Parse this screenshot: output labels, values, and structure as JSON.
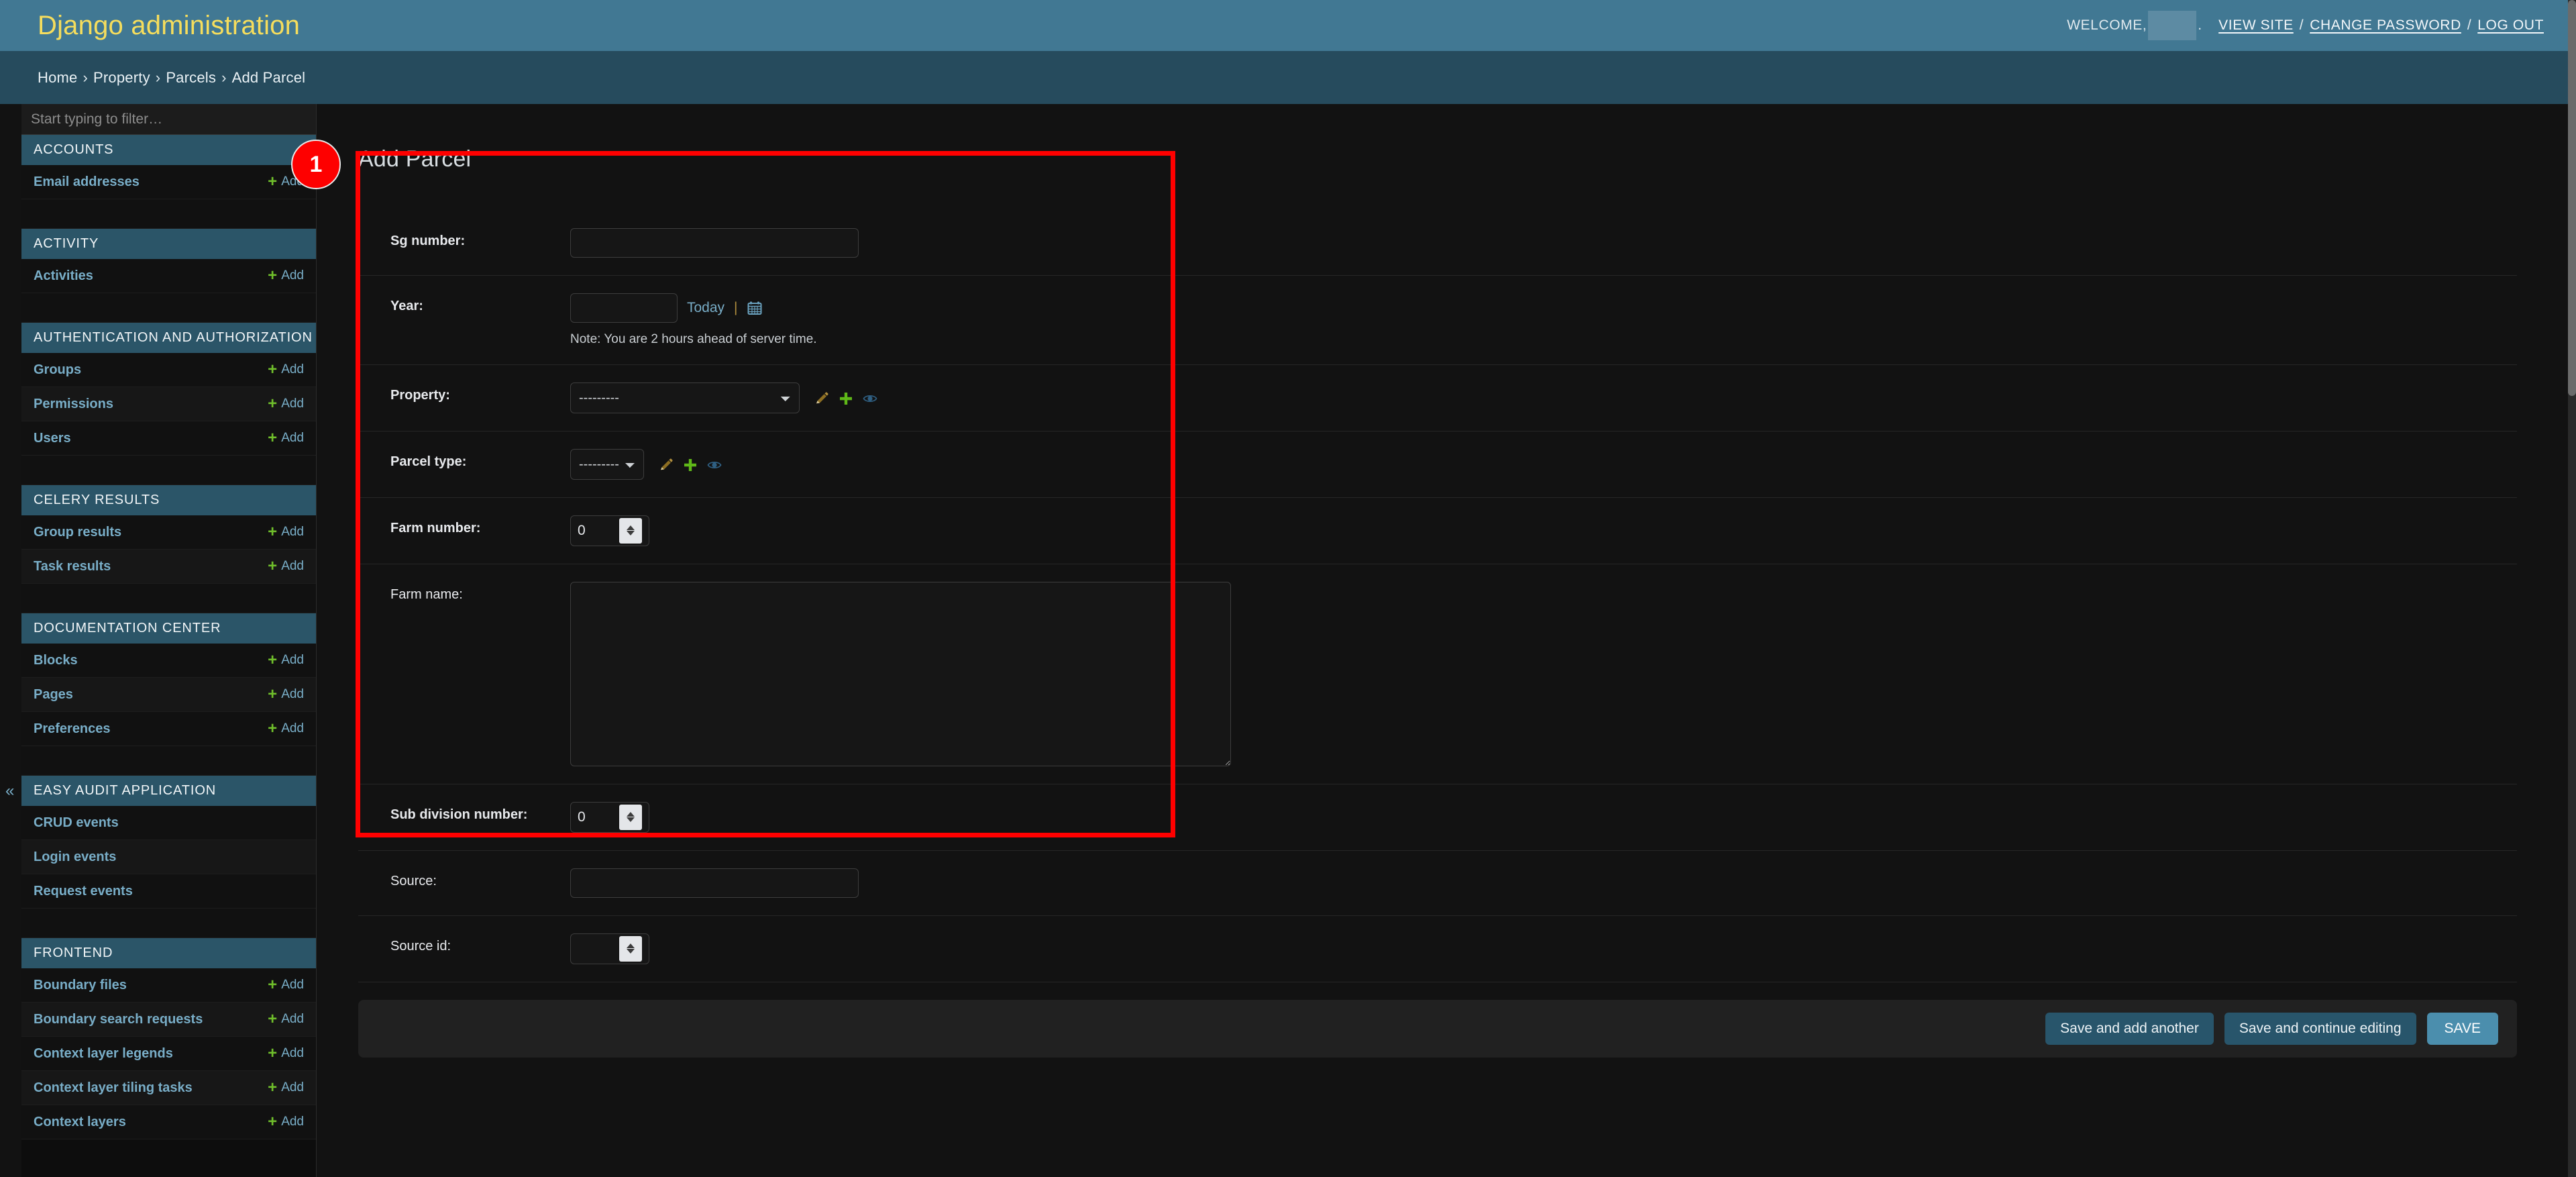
{
  "header": {
    "branding": "Django administration",
    "welcome_prefix": "WELCOME,",
    "username_redacted": "",
    "period": ".",
    "view_site": "VIEW SITE",
    "change_password": "CHANGE PASSWORD",
    "log_out": "LOG OUT",
    "separator": "/",
    "brand_color": "#f5dd5d",
    "bg_color": "#417893"
  },
  "breadcrumbs": {
    "separator": "›",
    "items": [
      "Home",
      "Property",
      "Parcels",
      "Add Parcel"
    ]
  },
  "sidebar": {
    "filter_placeholder": "Start typing to filter…",
    "collapse_glyph": "«",
    "add_label": "Add",
    "plus_glyph": "+",
    "apps": [
      {
        "caption": "ACCOUNTS",
        "models": [
          {
            "label": "Email addresses",
            "add": "Add"
          }
        ]
      },
      {
        "caption": "ACTIVITY",
        "models": [
          {
            "label": "Activities",
            "add": "Add"
          }
        ]
      },
      {
        "caption": "AUTHENTICATION AND AUTHORIZATION",
        "models": [
          {
            "label": "Groups",
            "add": "Add"
          },
          {
            "label": "Permissions",
            "add": "Add"
          },
          {
            "label": "Users",
            "add": "Add"
          }
        ]
      },
      {
        "caption": "CELERY RESULTS",
        "models": [
          {
            "label": "Group results",
            "add": "Add"
          },
          {
            "label": "Task results",
            "add": "Add"
          }
        ]
      },
      {
        "caption": "DOCUMENTATION CENTER",
        "models": [
          {
            "label": "Blocks",
            "add": "Add"
          },
          {
            "label": "Pages",
            "add": "Add"
          },
          {
            "label": "Preferences",
            "add": "Add"
          }
        ]
      },
      {
        "caption": "EASY AUDIT APPLICATION",
        "models": [
          {
            "label": "CRUD events",
            "add": ""
          },
          {
            "label": "Login events",
            "add": ""
          },
          {
            "label": "Request events",
            "add": ""
          }
        ]
      },
      {
        "caption": "FRONTEND",
        "models": [
          {
            "label": "Boundary files",
            "add": "Add"
          },
          {
            "label": "Boundary search requests",
            "add": "Add"
          },
          {
            "label": "Context layer legends",
            "add": "Add"
          },
          {
            "label": "Context layer tiling tasks",
            "add": "Add"
          },
          {
            "label": "Context layers",
            "add": "Add"
          }
        ]
      }
    ]
  },
  "main": {
    "title": "Add Parcel",
    "fields": {
      "sg_number": {
        "label": "Sg number:",
        "value": "",
        "required": true
      },
      "year": {
        "label": "Year:",
        "value": "",
        "required": true,
        "today_link": "Today",
        "pipe": "|",
        "calendar_icon": "calendar-icon",
        "help_text": "Note: You are 2 hours ahead of server time."
      },
      "property": {
        "label": "Property:",
        "required": true,
        "selected": "---------",
        "options": [
          "---------"
        ],
        "widgets": [
          "change-related-pencil-icon",
          "add-related-plus-icon",
          "view-related-eye-icon"
        ]
      },
      "parcel_type": {
        "label": "Parcel type:",
        "required": true,
        "selected": "---------",
        "options": [
          "---------"
        ],
        "widgets": [
          "change-related-pencil-icon",
          "add-related-plus-icon",
          "view-related-eye-icon"
        ]
      },
      "farm_number": {
        "label": "Farm number:",
        "value": "0",
        "required": true
      },
      "farm_name": {
        "label": "Farm name:",
        "value": "",
        "required": false
      },
      "sub_division_number": {
        "label": "Sub division number:",
        "value": "0",
        "required": true
      },
      "source": {
        "label": "Source:",
        "value": "",
        "required": false
      },
      "source_id": {
        "label": "Source id:",
        "value": "",
        "required": false
      }
    },
    "submit_row": {
      "save_and_add_another": "Save and add another",
      "save_and_continue": "Save and continue editing",
      "save": "SAVE"
    }
  },
  "annotation": {
    "badge_number": "1",
    "badge_color": "#fe0000",
    "box_color": "#ff0000"
  }
}
